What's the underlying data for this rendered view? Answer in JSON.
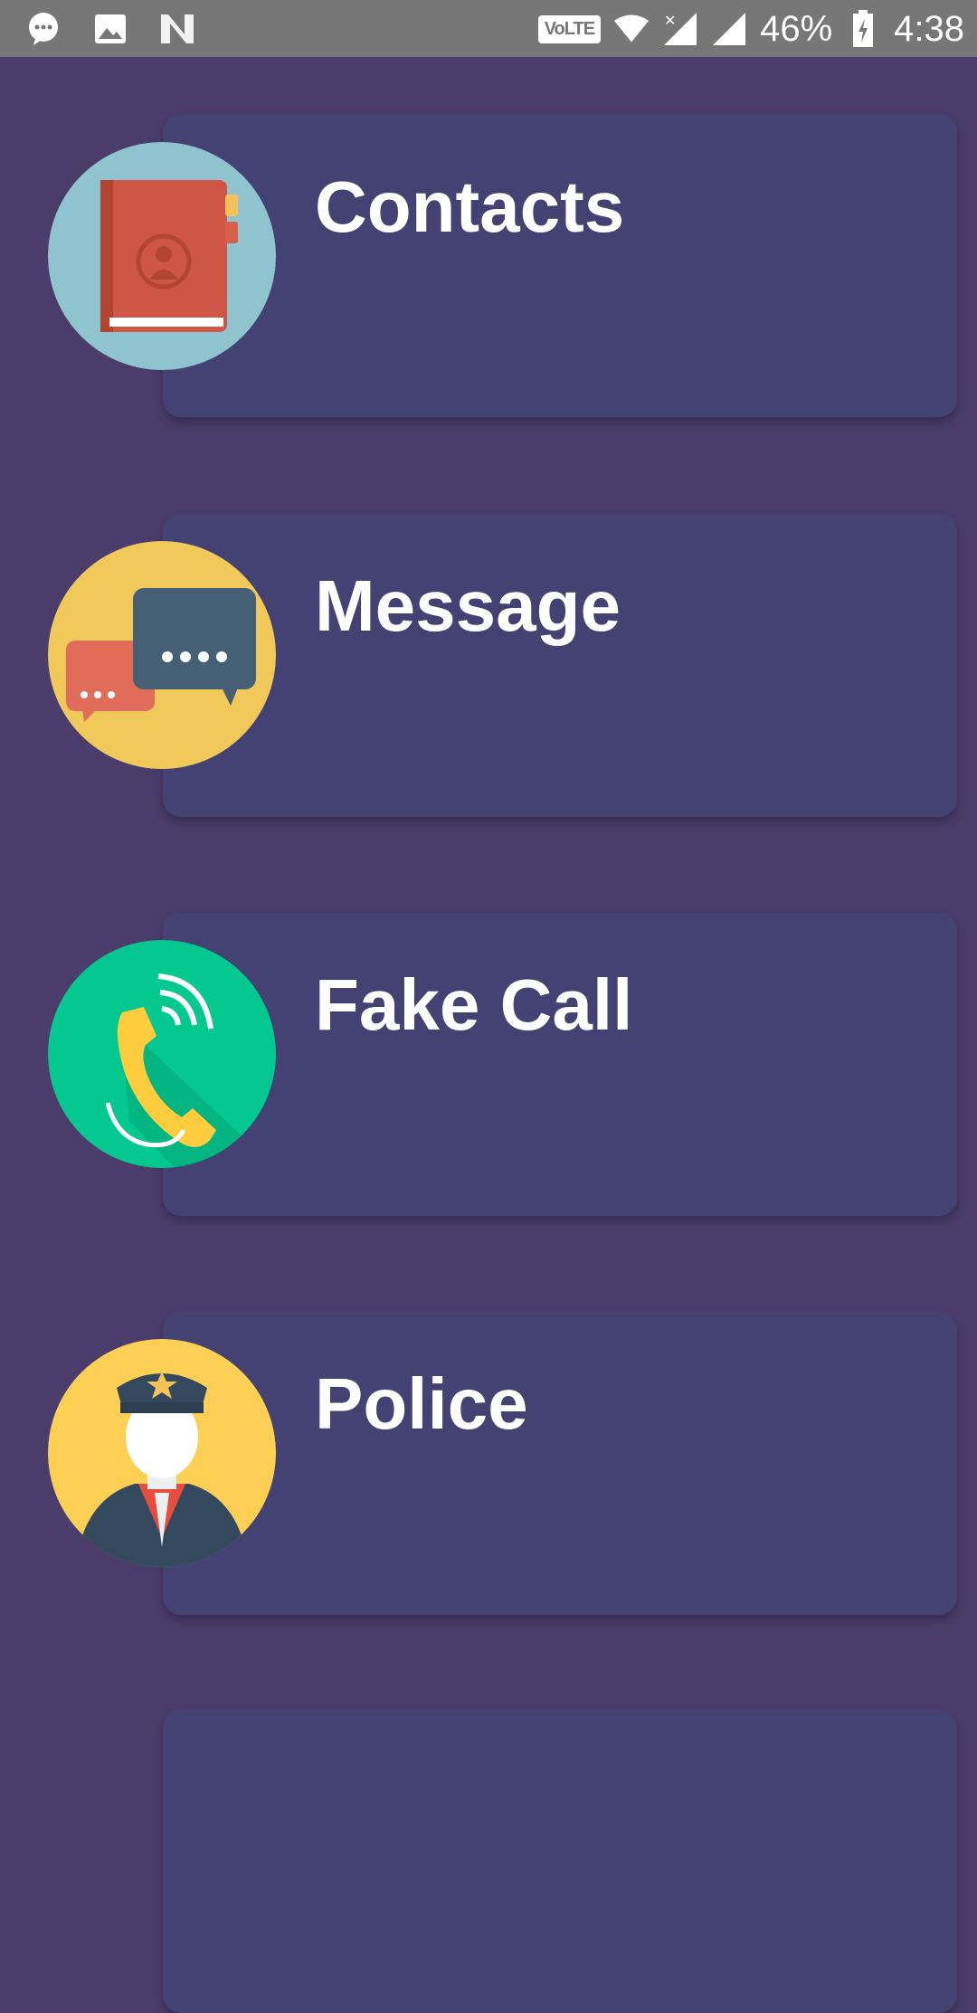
{
  "theme": {
    "background": "#4a3d6b",
    "card": "#444272",
    "statusbar": "#777777"
  },
  "status_bar": {
    "left_icons": [
      "messenger-icon",
      "image-icon",
      "n-icon"
    ],
    "volte": "VoLTE",
    "battery_percent": "46%",
    "time": "4:38"
  },
  "menu": [
    {
      "label": "Contacts",
      "icon": "address-book-icon",
      "icon_bg": "#8fc4ce"
    },
    {
      "label": "Message",
      "icon": "chat-bubbles-icon",
      "icon_bg": "#f0c95a"
    },
    {
      "label": "Fake Call",
      "icon": "phone-call-icon",
      "icon_bg": "#05c891"
    },
    {
      "label": "Police",
      "icon": "police-officer-icon",
      "icon_bg": "#fdcf55"
    }
  ]
}
